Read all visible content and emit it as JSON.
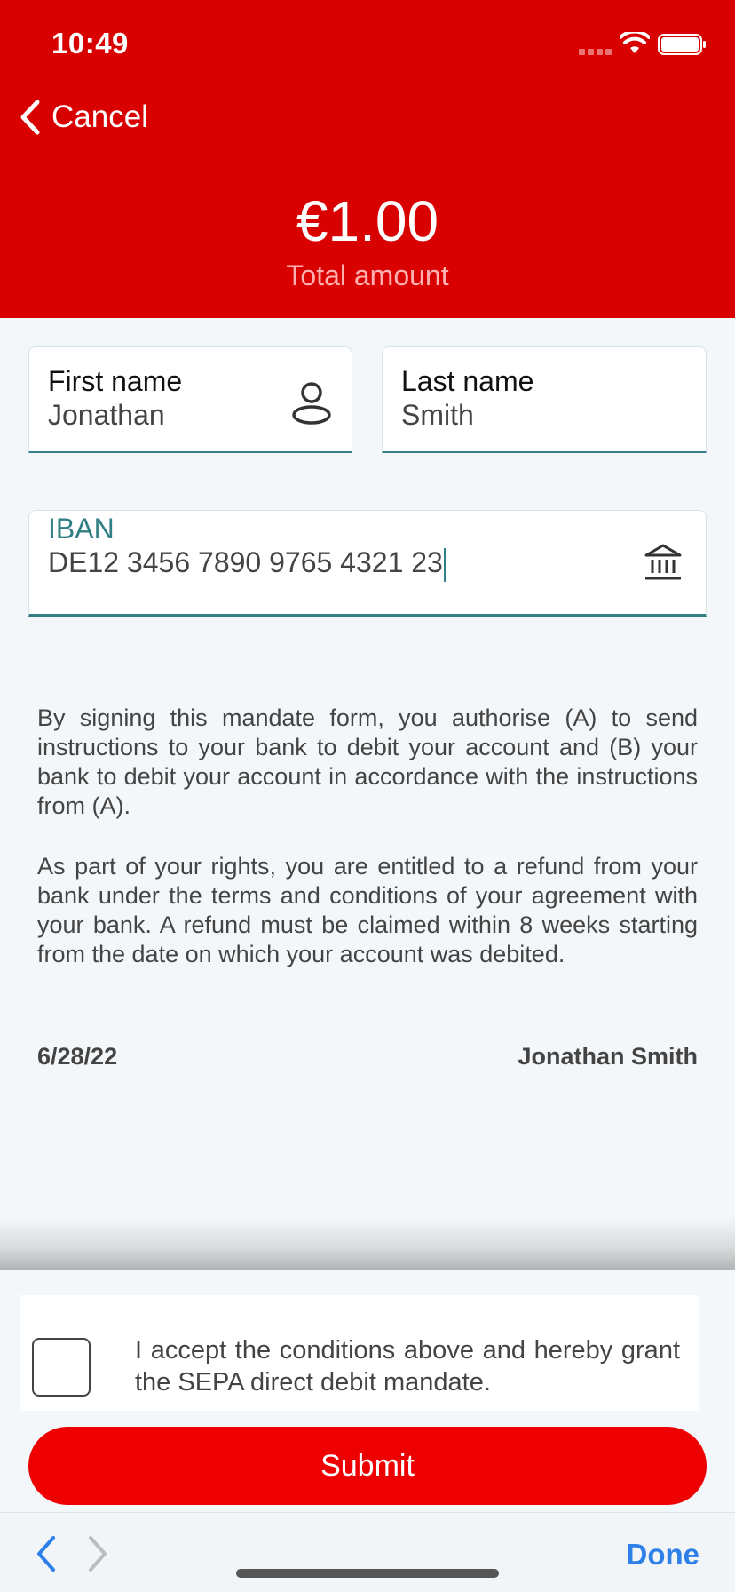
{
  "status_bar": {
    "time": "10:49"
  },
  "header": {
    "cancel_label": "Cancel",
    "amount": "€1.00",
    "amount_label": "Total amount"
  },
  "form": {
    "first_name": {
      "label": "First name",
      "value": "Jonathan"
    },
    "last_name": {
      "label": "Last name",
      "value": "Smith"
    },
    "iban": {
      "label": "IBAN",
      "value": "DE12 3456 7890 9765 4321 23"
    }
  },
  "mandate": {
    "paragraph1": "By signing this mandate form, you authorise (A) to send instructions to your bank to debit your account and (B) your bank to debit your account in accordance with the instructions from (A).",
    "paragraph2": "As part of your rights, you are entitled to a refund from your bank under the terms and conditions of your agreement with your bank. A refund must be claimed within 8 weeks starting from the date on which your account was debited.",
    "date": "6/28/22",
    "signatory": "Jonathan Smith"
  },
  "accept": {
    "checked": false,
    "text": "I accept the conditions above and hereby grant the SEPA direct debit mandate."
  },
  "submit_label": "Submit",
  "keyboard_toolbar": {
    "done_label": "Done"
  },
  "colors": {
    "brand_red": "#d90000",
    "button_red": "#ee0000",
    "accent_teal": "#2f7f85",
    "link_blue": "#2e7fe8"
  }
}
